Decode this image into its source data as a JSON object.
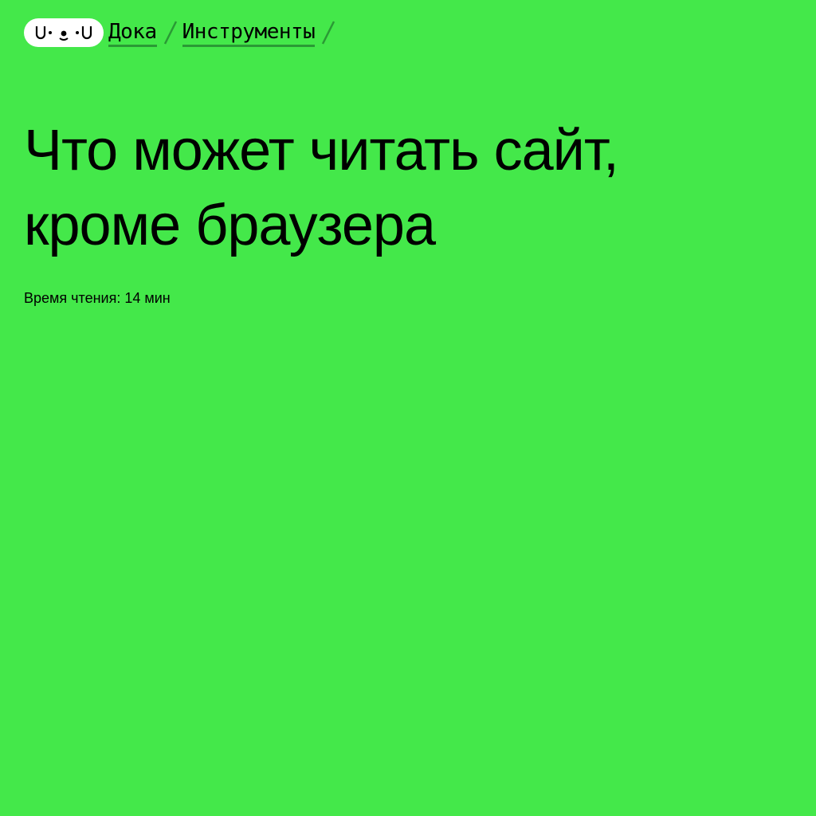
{
  "theme": {
    "background": "#44e84a",
    "link_underline": "#2a9a35",
    "text": "#000000"
  },
  "header": {
    "logo": {
      "icon": "doka-face-logo-icon",
      "text": "U•ᴥ•U"
    },
    "breadcrumbs": [
      {
        "label": "Дока"
      },
      {
        "label": "Инструменты"
      }
    ],
    "separator_icon": "slash-separator-icon"
  },
  "article": {
    "title": "Что может читать сайт, кроме браузера",
    "reading_time": "Время чтения: 14 мин"
  }
}
